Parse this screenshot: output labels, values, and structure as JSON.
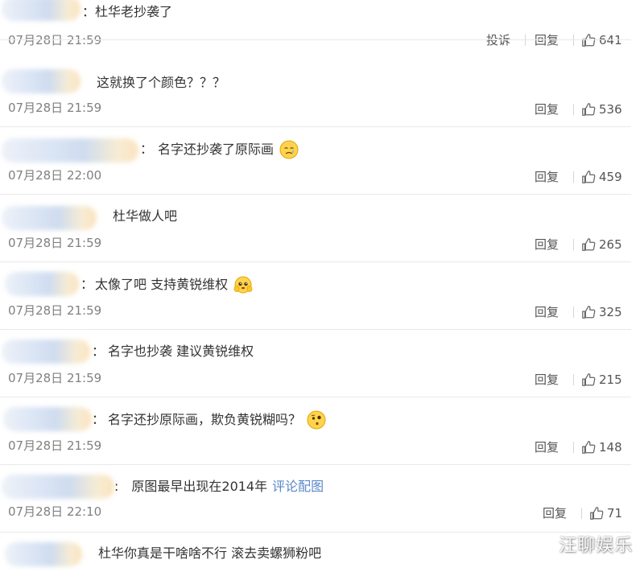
{
  "comments": [
    {
      "text_prefix": "：",
      "text": "杜华老抄袭了",
      "date": "07月28日 21:59",
      "report": "投诉",
      "reply": "回复",
      "likes": "641"
    },
    {
      "text_prefix": "",
      "text": "这就换了个颜色？？？",
      "date": "07月28日 21:59",
      "reply": "回复",
      "likes": "536"
    },
    {
      "text_prefix": "：",
      "text": "名字还抄袭了原际画",
      "date": "07月28日 22:00",
      "reply": "回复",
      "likes": "459",
      "emoji": "crying-face-emoji"
    },
    {
      "text_prefix": "",
      "text": "杜华做人吧",
      "date": "07月28日 21:59",
      "reply": "回复",
      "likes": "265"
    },
    {
      "text_prefix": "：",
      "text": "太像了吧 支持黄锐维权",
      "date": "07月28日 21:59",
      "reply": "回复",
      "likes": "325",
      "emoji": "pleading-face-emoji"
    },
    {
      "text_prefix": "：",
      "text": "名字也抄袭 建议黄锐维权",
      "date": "07月28日 21:59",
      "reply": "回复",
      "likes": "215"
    },
    {
      "text_prefix": "：",
      "text": "名字还抄原际画，欺负黄锐糊吗？",
      "date": "07月28日 21:59",
      "reply": "回复",
      "likes": "148",
      "emoji": "thinking-face-emoji"
    },
    {
      "text_prefix": ":",
      "text": "原图最早出现在2014年",
      "link": "评论配图",
      "date": "07月28日 22:10",
      "reply": "回复",
      "likes": "71"
    },
    {
      "text_prefix": "",
      "text": "杜华你真是干啥啥不行 滚去卖螺狮粉吧"
    }
  ],
  "watermark": "汪聊娱乐",
  "colors": {
    "divider": "#e9e9e9",
    "link": "#5a88c8",
    "date": "#808080"
  }
}
